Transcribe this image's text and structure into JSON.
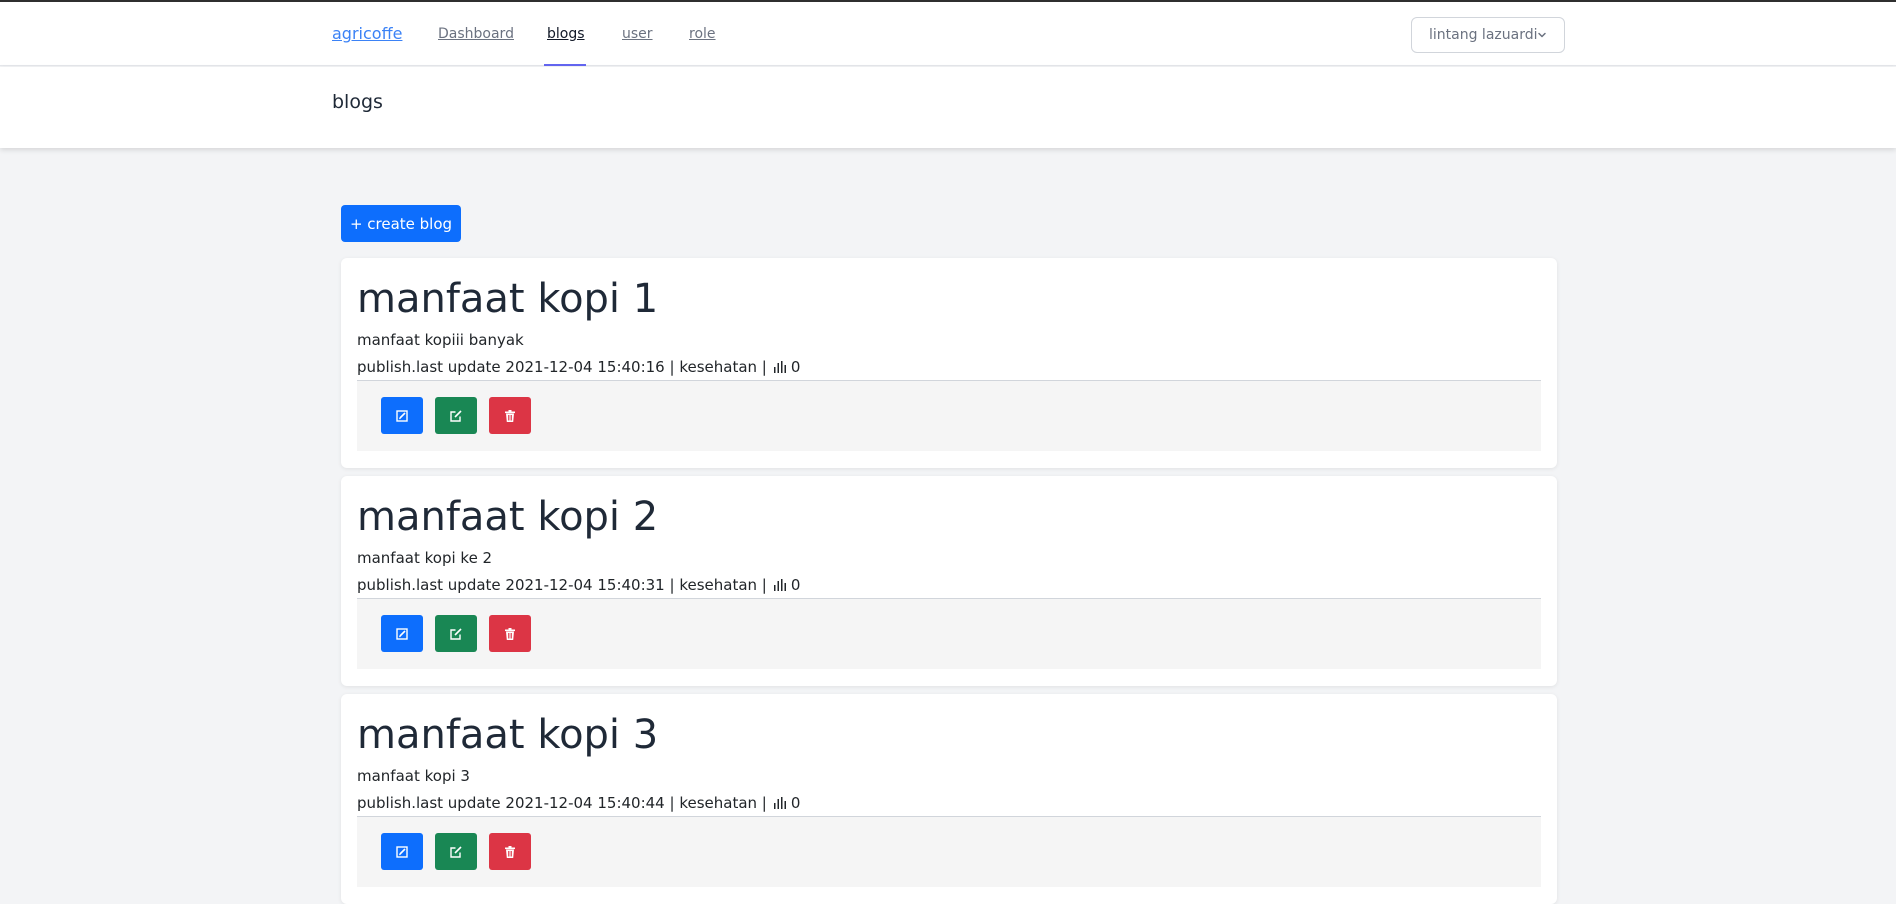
{
  "nav": {
    "brand": "agricoffe",
    "links": [
      {
        "label": "Dashboard"
      },
      {
        "label": "blogs",
        "active": true
      },
      {
        "label": "user"
      },
      {
        "label": "role"
      }
    ],
    "user_name": "lintang lazuardi"
  },
  "header": {
    "title": "blogs"
  },
  "create_button": "+ create blog",
  "blogs": [
    {
      "title": "manfaat kopi 1",
      "description": "manfaat kopiii banyak",
      "meta_prefix": "publish.last update 2021-12-04 15:40:16 | kesehatan |",
      "views": "0"
    },
    {
      "title": "manfaat kopi 2",
      "description": "manfaat kopi ke 2",
      "meta_prefix": "publish.last update 2021-12-04 15:40:31 | kesehatan |",
      "views": "0"
    },
    {
      "title": "manfaat kopi 3",
      "description": "manfaat kopi 3",
      "meta_prefix": "publish.last update 2021-12-04 15:40:44 | kesehatan |",
      "views": "0"
    }
  ],
  "colors": {
    "primary": "#0d6efd",
    "success": "#198754",
    "danger": "#dc3545",
    "brand_link": "#3b82f6",
    "active_underline": "#6366f1"
  },
  "icons": {
    "edit": "edit-icon",
    "open": "external-edit-icon",
    "delete": "trash-icon",
    "views": "bar-chart-icon",
    "dropdown": "chevron-down-icon"
  }
}
